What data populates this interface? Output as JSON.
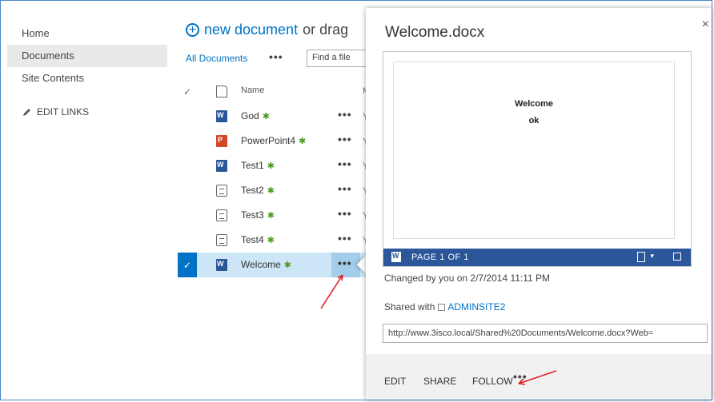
{
  "nav": {
    "items": [
      {
        "label": "Home",
        "selected": false
      },
      {
        "label": "Documents",
        "selected": true
      },
      {
        "label": "Site Contents",
        "selected": false
      }
    ],
    "edit_links": "EDIT LINKS"
  },
  "toolbar": {
    "new_document": "new document",
    "or_drag": "or drag",
    "view": "All Documents",
    "more": "•••",
    "find_placeholder": "Find a file"
  },
  "list": {
    "header_name": "Name",
    "header_next": "M",
    "rows": [
      {
        "name": "God",
        "icon": "word-doc-icon",
        "col": "Y"
      },
      {
        "name": "PowerPoint4",
        "icon": "powerpoint-doc-icon",
        "col": "Y"
      },
      {
        "name": "Test1",
        "icon": "word-doc-icon",
        "col": "Y"
      },
      {
        "name": "Test2",
        "icon": "generic-doc-icon",
        "col": "Y"
      },
      {
        "name": "Test3",
        "icon": "generic-doc-icon",
        "col": "Y"
      },
      {
        "name": "Test4",
        "icon": "generic-doc-icon",
        "col": "Y"
      },
      {
        "name": "Welcome",
        "icon": "word-doc-icon",
        "col": "",
        "selected": true
      }
    ],
    "new_marker": "✱",
    "dots": "•••"
  },
  "callout": {
    "title": "Welcome.docx",
    "close": "×",
    "preview": {
      "line1": "Welcome",
      "line2": "ok",
      "page_label": "PAGE 1 OF 1"
    },
    "changed": "Changed by you on 2/7/2014 11:11 PM",
    "shared_prefix": "Shared with",
    "shared_with": "ADMINSITE2",
    "url": "http://www.3isco.local/Shared%20Documents/Welcome.docx?Web=",
    "actions": {
      "edit": "EDIT",
      "share": "SHARE",
      "follow": "FOLLOW",
      "more": "•••"
    }
  },
  "colors": {
    "accent": "#0072c6",
    "word": "#2b579a",
    "powerpoint": "#d24726",
    "annotation": "#e02020"
  }
}
